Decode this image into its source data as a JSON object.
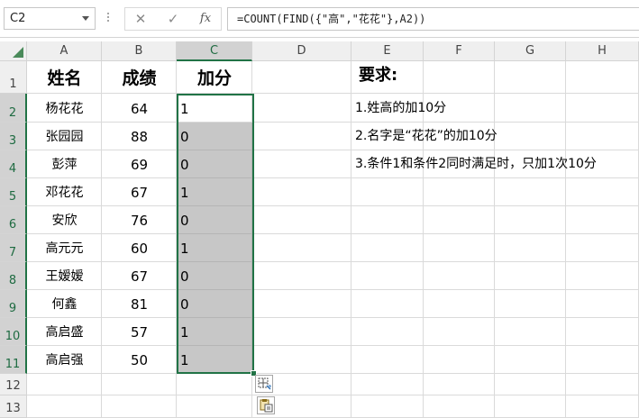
{
  "formula_bar": {
    "name_box": "C2",
    "cancel_glyph": "✕",
    "enter_glyph": "✓",
    "fx_label": "fx",
    "formula": "=COUNT(FIND({\"高\",\"花花\"},A2))"
  },
  "columns": [
    "A",
    "B",
    "C",
    "D",
    "E",
    "F",
    "G",
    "H"
  ],
  "rows": [
    "1",
    "2",
    "3",
    "4",
    "5",
    "6",
    "7",
    "8",
    "9",
    "10",
    "11",
    "12",
    "13"
  ],
  "table": {
    "headers": [
      "姓名",
      "成绩",
      "加分"
    ],
    "records": [
      [
        "杨花花",
        "64",
        "1"
      ],
      [
        "张园园",
        "88",
        "0"
      ],
      [
        "彭萍",
        "69",
        "0"
      ],
      [
        "邓花花",
        "67",
        "1"
      ],
      [
        "安欣",
        "76",
        "0"
      ],
      [
        "高元元",
        "60",
        "1"
      ],
      [
        "王嫒嫒",
        "67",
        "0"
      ],
      [
        "何鑫",
        "81",
        "0"
      ],
      [
        "高启盛",
        "57",
        "1"
      ],
      [
        "高启强",
        "50",
        "1"
      ]
    ]
  },
  "requirements": {
    "title": "要求:",
    "items": [
      "1.姓高的加10分",
      "2.名字是“花花”的加10分",
      "3.条件1和条件2同时满足时，只加1次10分"
    ]
  },
  "icons": {
    "quick_analysis": "quick-analysis-icon",
    "paste_options": "paste-options-icon"
  },
  "colors": {
    "selection": "#217346",
    "selected_fill": "#c7c7c7",
    "header_bg": "#efefef"
  }
}
